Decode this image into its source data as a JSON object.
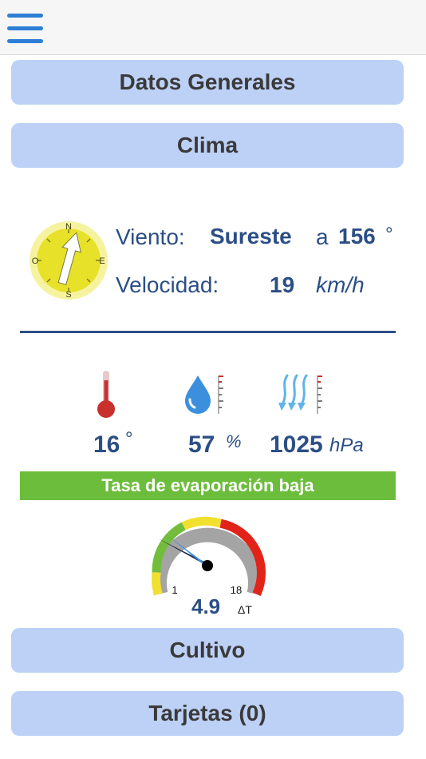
{
  "header": {
    "menu_icon": "hamburger-menu-icon"
  },
  "sections": {
    "general": "Datos Generales",
    "climate": "Clima",
    "crop": "Cultivo",
    "cards": "Tarjetas (0)"
  },
  "compass": {
    "north": "N",
    "south": "S",
    "east": "E",
    "west": "O",
    "needle_degrees": 156
  },
  "wind": {
    "direction_label": "Viento:",
    "direction_value": "Sureste",
    "angle_prefix": "a",
    "angle_value": "156",
    "angle_unit": "°",
    "speed_label": "Velocidad:",
    "speed_value": "19",
    "speed_unit": "km/h"
  },
  "readings": {
    "temperature_value": "16",
    "temperature_unit": "°",
    "humidity_value": "57",
    "humidity_unit": "%",
    "pressure_value": "1025",
    "pressure_unit": "hPa"
  },
  "evaporation": {
    "status": "Tasa de evaporación baja",
    "gauge_min": "1",
    "gauge_max": "18",
    "value": "4.9",
    "unit": "ΔT",
    "needle_value": 4.9
  },
  "colors": {
    "accent_blue": "#2c4e86",
    "button_bg": "#bdd1f6",
    "banner_green": "#6cbd3c",
    "gauge_red": "#e2231a",
    "gauge_yellow": "#f1e02e",
    "gauge_green": "#72bd3b"
  }
}
